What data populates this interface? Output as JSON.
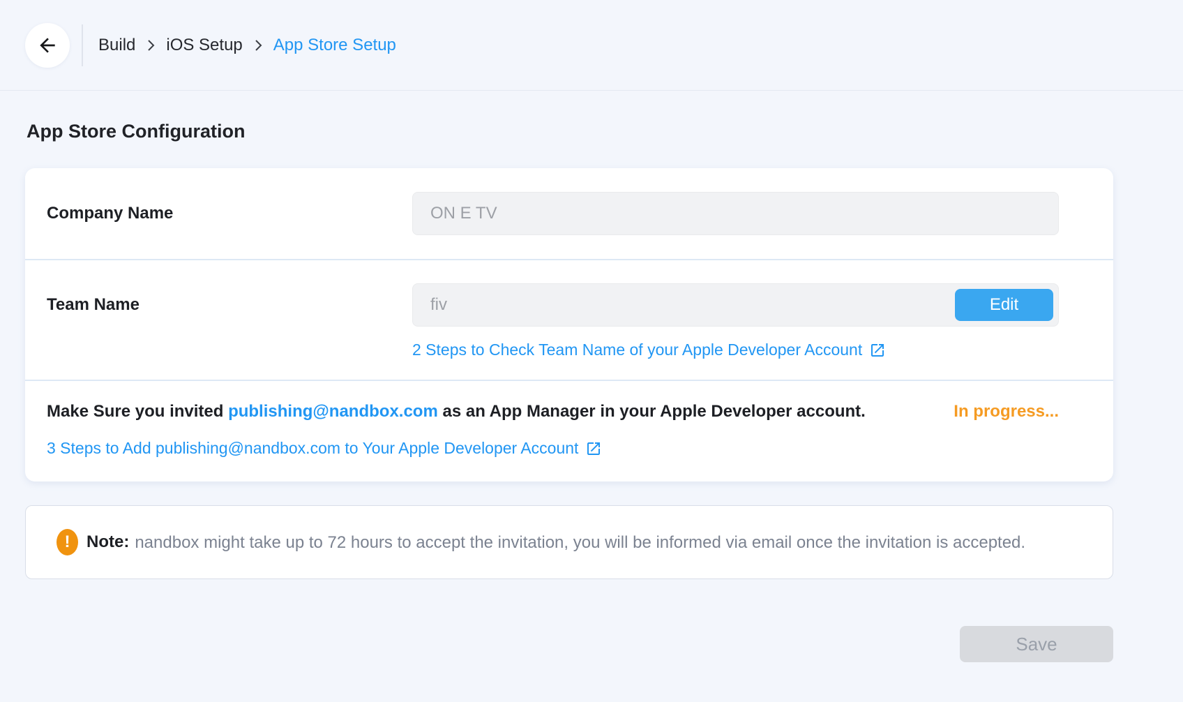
{
  "header": {
    "breadcrumb": [
      {
        "label": "Build"
      },
      {
        "label": "iOS Setup"
      },
      {
        "label": "App Store Setup"
      }
    ]
  },
  "section_title": "App Store Configuration",
  "config_card": {
    "company_name": {
      "label": "Company Name",
      "value": "ON E TV"
    },
    "team_name": {
      "label": "Team Name",
      "value": "fiv",
      "edit_button": "Edit",
      "help_link": "2 Steps to Check Team Name of your Apple Developer Account"
    },
    "invite": {
      "text_before": "Make Sure you invited ",
      "email": "publishing@nandbox.com",
      "text_after": " as an App Manager in your Apple Developer account.",
      "status": "In progress...",
      "help_link": "3 Steps to Add publishing@nandbox.com to Your Apple Developer Account"
    }
  },
  "note": {
    "icon_glyph": "!",
    "label": "Note:",
    "text": "nandbox might take up to 72 hours to accept the invitation, you will be informed via email once the invitation is accepted."
  },
  "actions": {
    "save_label": "Save"
  },
  "colors": {
    "link_blue": "#2196f3",
    "edit_button_blue": "#3aa7f0",
    "status_orange": "#f59b23",
    "note_icon_orange": "#f0930f",
    "page_background": "#f3f6fc"
  }
}
